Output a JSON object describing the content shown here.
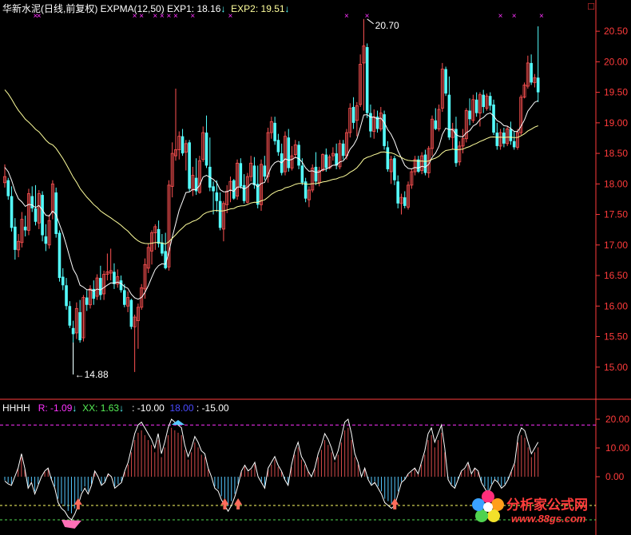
{
  "header": {
    "title": "华新水泥(日线,前复权)",
    "indicator": "EXPMA(12,50)",
    "exp1_label": "EXP1:",
    "exp1_value": "18.16",
    "exp2_label": "EXP2:",
    "exp2_value": "19.51",
    "arrow_down": "↓",
    "corner_box": "□"
  },
  "sub_header": {
    "name": "HHHH",
    "r_label": "R:",
    "r_value": "-1.09",
    "xx_label": "XX:",
    "xx_value": "1.63",
    "l3": ": -10.00",
    "l4": "18.00",
    "l5": ": -15.00"
  },
  "watermark": {
    "brand": "分析家公式网",
    "url": "www.88gs.com"
  },
  "colors": {
    "up": "#ff5252",
    "down": "#54ffff",
    "exp1": "#ffffff",
    "exp2": "#ffff9c",
    "axis": "#ff3b3b",
    "magenta_marks": "#ff33ff",
    "dash_top": "#ff33ff",
    "dash_mid": "#ffff66",
    "dash_low": "#55dd55"
  },
  "chart_data": [
    {
      "type": "candlestick",
      "title": "华新水泥(日线,前复权)",
      "ylim": [
        14.5,
        20.75
      ],
      "yticks": [
        "15.00",
        "15.50",
        "16.00",
        "16.50",
        "17.00",
        "17.50",
        "18.00",
        "18.50",
        "19.00",
        "19.50",
        "20.00",
        "20.50"
      ],
      "annotations": [
        {
          "label": "←14.88",
          "value": 14.88,
          "index": 20
        },
        {
          "label": "20.70",
          "value": 20.7,
          "index": 106
        }
      ],
      "top_marks": "× markers along top edge",
      "ohlc": [
        [
          18.02,
          18.32,
          17.94,
          18.12
        ],
        [
          18.06,
          18.1,
          17.74,
          17.8
        ],
        [
          17.8,
          17.96,
          17.22,
          17.28
        ],
        [
          17.3,
          17.44,
          16.76,
          16.92
        ],
        [
          16.92,
          17.18,
          16.8,
          17.06
        ],
        [
          17.04,
          17.54,
          16.96,
          17.42
        ],
        [
          17.3,
          17.48,
          17.14,
          17.24
        ],
        [
          17.24,
          17.92,
          17.16,
          17.84
        ],
        [
          17.8,
          17.96,
          17.54,
          17.6
        ],
        [
          17.6,
          17.98,
          17.32,
          17.38
        ],
        [
          17.36,
          17.9,
          17.26,
          17.84
        ],
        [
          17.82,
          17.88,
          17.06,
          17.16
        ],
        [
          17.14,
          17.34,
          16.9,
          17.02
        ],
        [
          17.0,
          17.5,
          16.94,
          17.4
        ],
        [
          17.54,
          18.06,
          17.42,
          18.0
        ],
        [
          17.86,
          17.94,
          17.12,
          17.18
        ],
        [
          17.2,
          17.24,
          16.4,
          16.46
        ],
        [
          16.48,
          16.62,
          16.26,
          16.34
        ],
        [
          16.34,
          16.46,
          15.94,
          16.0
        ],
        [
          16.0,
          16.08,
          15.64,
          15.68
        ],
        [
          15.64,
          15.76,
          14.88,
          15.54
        ],
        [
          15.56,
          16.06,
          15.46,
          15.96
        ],
        [
          15.9,
          16.1,
          15.4,
          15.44
        ],
        [
          15.48,
          16.18,
          15.42,
          16.14
        ],
        [
          16.14,
          16.26,
          15.92,
          16.02
        ],
        [
          16.02,
          16.34,
          15.96,
          16.28
        ],
        [
          16.28,
          16.42,
          16.02,
          16.12
        ],
        [
          16.16,
          16.52,
          16.1,
          16.46
        ],
        [
          16.46,
          16.66,
          16.1,
          16.18
        ],
        [
          16.2,
          16.58,
          16.1,
          16.52
        ],
        [
          16.52,
          16.86,
          16.42,
          16.56
        ],
        [
          16.54,
          16.94,
          16.42,
          16.58
        ],
        [
          16.56,
          16.7,
          16.28,
          16.36
        ],
        [
          16.36,
          16.6,
          16.3,
          16.48
        ],
        [
          16.42,
          16.5,
          16.22,
          16.26
        ],
        [
          16.26,
          16.36,
          15.98,
          16.02
        ],
        [
          16.0,
          16.24,
          15.9,
          16.14
        ],
        [
          16.1,
          16.12,
          15.62,
          15.66
        ],
        [
          15.66,
          15.86,
          14.92,
          15.82
        ],
        [
          15.76,
          16.04,
          15.3,
          15.98
        ],
        [
          15.98,
          16.36,
          15.94,
          16.3
        ],
        [
          16.28,
          16.78,
          16.12,
          16.68
        ],
        [
          16.62,
          17.02,
          16.54,
          16.96
        ],
        [
          16.9,
          17.24,
          16.68,
          17.2
        ],
        [
          17.2,
          17.34,
          16.92,
          17.3
        ],
        [
          17.26,
          17.4,
          16.96,
          17.02
        ],
        [
          17.04,
          17.18,
          16.82,
          16.86
        ],
        [
          16.9,
          17.2,
          16.6,
          16.62
        ],
        [
          16.64,
          18.06,
          16.58,
          17.98
        ],
        [
          17.96,
          18.68,
          17.78,
          18.5
        ],
        [
          18.46,
          19.56,
          18.38,
          18.56
        ],
        [
          18.56,
          18.86,
          18.4,
          18.78
        ],
        [
          18.78,
          18.9,
          18.46,
          18.5
        ],
        [
          18.52,
          18.72,
          18.22,
          18.66
        ],
        [
          18.68,
          18.72,
          17.88,
          17.92
        ],
        [
          17.9,
          18.28,
          17.8,
          18.14
        ],
        [
          18.1,
          18.42,
          17.82,
          17.88
        ],
        [
          17.86,
          18.46,
          17.84,
          18.38
        ],
        [
          18.4,
          18.94,
          18.36,
          18.84
        ],
        [
          18.84,
          19.12,
          18.26,
          18.3
        ],
        [
          18.28,
          18.76,
          17.88,
          17.94
        ],
        [
          17.96,
          18.04,
          17.5,
          17.88
        ],
        [
          17.86,
          18.06,
          17.54,
          17.72
        ],
        [
          17.72,
          17.86,
          17.24,
          17.28
        ],
        [
          17.26,
          17.72,
          17.06,
          17.68
        ],
        [
          17.66,
          17.98,
          17.52,
          17.88
        ],
        [
          17.9,
          18.12,
          17.7,
          18.04
        ],
        [
          18.06,
          18.08,
          17.74,
          17.76
        ],
        [
          17.8,
          18.4,
          17.74,
          18.34
        ],
        [
          18.34,
          18.42,
          17.92,
          17.96
        ],
        [
          17.98,
          18.16,
          17.68,
          17.72
        ],
        [
          17.7,
          18.18,
          17.68,
          18.12
        ],
        [
          18.12,
          18.46,
          18.04,
          18.34
        ],
        [
          18.3,
          18.44,
          17.92,
          17.98
        ],
        [
          18.0,
          18.3,
          17.6,
          17.66
        ],
        [
          17.66,
          18.4,
          17.56,
          18.32
        ],
        [
          18.3,
          18.46,
          18.06,
          18.12
        ],
        [
          18.12,
          18.92,
          18.02,
          18.84
        ],
        [
          18.84,
          19.1,
          18.74,
          19.02
        ],
        [
          19.0,
          19.1,
          18.64,
          18.7
        ],
        [
          18.72,
          18.82,
          18.46,
          18.52
        ],
        [
          18.5,
          18.66,
          18.14,
          18.18
        ],
        [
          18.2,
          18.86,
          18.14,
          18.78
        ],
        [
          18.76,
          18.9,
          18.2,
          18.26
        ],
        [
          18.26,
          18.62,
          18.22,
          18.46
        ],
        [
          18.48,
          18.72,
          18.42,
          18.64
        ],
        [
          18.64,
          18.7,
          18.24,
          18.3
        ],
        [
          18.3,
          18.42,
          17.98,
          18.02
        ],
        [
          18.04,
          18.1,
          17.7,
          17.76
        ],
        [
          17.74,
          17.96,
          17.62,
          17.9
        ],
        [
          17.9,
          18.32,
          17.86,
          18.26
        ],
        [
          18.28,
          18.52,
          17.98,
          18.04
        ],
        [
          18.02,
          18.28,
          17.96,
          18.22
        ],
        [
          18.22,
          18.5,
          18.2,
          18.48
        ],
        [
          18.48,
          18.58,
          18.2,
          18.26
        ],
        [
          18.26,
          18.48,
          18.24,
          18.44
        ],
        [
          18.46,
          18.6,
          18.38,
          18.5
        ],
        [
          18.5,
          18.66,
          18.24,
          18.3
        ],
        [
          18.28,
          18.72,
          18.24,
          18.66
        ],
        [
          18.66,
          18.72,
          18.4,
          18.46
        ],
        [
          18.46,
          18.9,
          18.4,
          18.84
        ],
        [
          18.84,
          19.32,
          18.76,
          19.24
        ],
        [
          19.26,
          19.42,
          18.9,
          19.0
        ],
        [
          19.04,
          19.34,
          18.78,
          19.28
        ],
        [
          19.3,
          20.12,
          19.26,
          19.96
        ],
        [
          19.98,
          20.7,
          19.2,
          20.26
        ],
        [
          20.24,
          20.3,
          19.08,
          19.16
        ],
        [
          19.16,
          19.3,
          18.76,
          18.86
        ],
        [
          18.86,
          19.22,
          18.74,
          19.1
        ],
        [
          19.1,
          19.2,
          18.84,
          18.9
        ],
        [
          18.9,
          19.26,
          18.86,
          19.16
        ],
        [
          19.14,
          19.2,
          18.56,
          18.62
        ],
        [
          18.6,
          18.7,
          18.2,
          18.24
        ],
        [
          18.2,
          18.46,
          18.0,
          18.4
        ],
        [
          18.42,
          18.46,
          17.98,
          18.06
        ],
        [
          18.04,
          18.14,
          17.6,
          17.68
        ],
        [
          17.68,
          17.84,
          17.5,
          17.78
        ],
        [
          17.78,
          17.88,
          17.6,
          17.64
        ],
        [
          17.62,
          18.04,
          17.58,
          17.98
        ],
        [
          17.98,
          18.24,
          17.92,
          18.2
        ],
        [
          18.2,
          18.46,
          18.14,
          18.4
        ],
        [
          18.4,
          18.46,
          18.18,
          18.2
        ],
        [
          18.22,
          18.52,
          18.16,
          18.46
        ],
        [
          18.48,
          18.56,
          18.14,
          18.18
        ],
        [
          18.18,
          18.62,
          18.1,
          18.58
        ],
        [
          18.58,
          19.12,
          18.46,
          19.06
        ],
        [
          19.04,
          19.24,
          18.88,
          18.9
        ],
        [
          18.9,
          19.3,
          18.86,
          19.22
        ],
        [
          19.24,
          19.98,
          19.18,
          19.88
        ],
        [
          19.88,
          19.92,
          19.44,
          19.48
        ],
        [
          19.46,
          19.76,
          18.72,
          18.76
        ],
        [
          18.76,
          19.0,
          18.56,
          18.9
        ],
        [
          18.9,
          19.1,
          18.28,
          18.34
        ],
        [
          18.36,
          18.7,
          18.3,
          18.62
        ],
        [
          18.62,
          18.9,
          18.5,
          18.74
        ],
        [
          18.74,
          19.24,
          18.68,
          19.2
        ],
        [
          19.2,
          19.4,
          18.96,
          19.06
        ],
        [
          19.04,
          19.46,
          19.0,
          19.38
        ],
        [
          19.38,
          19.5,
          19.1,
          19.16
        ],
        [
          19.16,
          19.5,
          18.94,
          19.46
        ],
        [
          19.46,
          19.54,
          19.16,
          19.26
        ],
        [
          19.24,
          19.48,
          19.2,
          19.44
        ],
        [
          19.44,
          19.5,
          19.2,
          19.28
        ],
        [
          19.3,
          19.38,
          18.8,
          18.84
        ],
        [
          18.84,
          19.0,
          18.56,
          18.62
        ],
        [
          18.62,
          18.9,
          18.56,
          18.84
        ],
        [
          18.84,
          18.92,
          18.6,
          18.66
        ],
        [
          18.66,
          18.94,
          18.62,
          18.9
        ],
        [
          18.9,
          19.02,
          18.64,
          18.7
        ],
        [
          18.7,
          18.86,
          18.56,
          18.6
        ],
        [
          18.6,
          18.9,
          18.56,
          18.84
        ],
        [
          18.84,
          19.46,
          18.8,
          19.42
        ],
        [
          19.42,
          19.66,
          19.4,
          19.62
        ],
        [
          19.6,
          20.1,
          19.56,
          19.98
        ],
        [
          19.98,
          20.12,
          19.62,
          19.66
        ],
        [
          19.66,
          19.8,
          19.58,
          19.74
        ],
        [
          19.74,
          20.58,
          19.34,
          19.5
        ]
      ]
    },
    {
      "type": "line+bar",
      "title": "HHHH",
      "ylim": [
        -10,
        21
      ],
      "yticks": [
        "20.00",
        "10.00",
        "0.00"
      ],
      "reference_lines": [
        18,
        -10,
        -15
      ],
      "series": [
        {
          "name": "R",
          "values": [
            -1.5,
            -2.5,
            -3,
            0,
            3,
            8,
            3,
            -4,
            -2,
            -6,
            -3,
            0,
            2,
            3,
            -1,
            -4,
            -9,
            -11,
            -12,
            -14,
            -15,
            -13,
            -10,
            -6,
            -4,
            -6,
            -3,
            2,
            0,
            -3,
            -2,
            1,
            0,
            -4,
            -3,
            -2,
            2,
            5,
            10,
            15,
            18,
            19,
            17,
            15,
            13,
            10,
            15,
            8,
            12,
            17,
            20,
            19,
            18,
            17,
            11,
            7,
            10,
            14,
            12,
            9,
            8,
            3,
            0,
            -4,
            -5,
            -8,
            -10,
            -12,
            -10,
            -7,
            -3,
            2,
            4,
            2,
            3,
            5,
            0,
            -2,
            -4,
            3,
            5,
            7,
            4,
            2,
            -1,
            -3,
            4,
            9,
            12,
            7,
            5,
            2,
            0,
            3,
            8,
            11,
            15,
            13,
            10,
            6,
            9,
            14,
            19,
            20,
            15,
            8,
            5,
            0,
            3,
            -1,
            -3,
            -2,
            -4,
            -6,
            -9,
            -10,
            -11,
            -10,
            -6,
            -2,
            -1,
            1,
            2,
            3,
            1,
            5,
            9,
            15,
            17,
            12,
            15,
            18,
            10,
            -1,
            -3,
            -4,
            -1,
            2,
            3,
            5,
            1,
            3,
            2,
            -2,
            -4,
            -6,
            -3,
            -1,
            -2,
            -4,
            -3,
            -1,
            2,
            5,
            14,
            17,
            16,
            12,
            8,
            10,
            12
          ]
        },
        {
          "name": "XX",
          "values": []
        }
      ]
    }
  ]
}
